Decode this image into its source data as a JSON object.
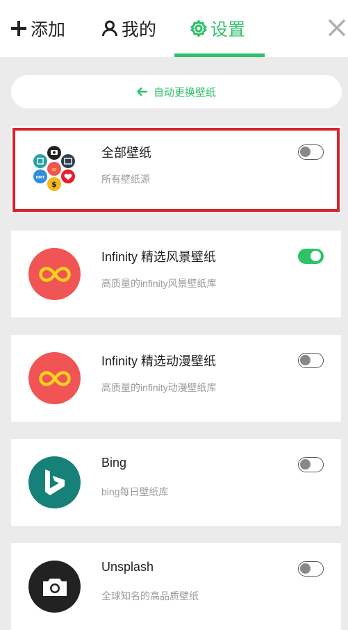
{
  "header": {
    "tabs": [
      {
        "label": "添加",
        "icon": "plus-icon",
        "active": false
      },
      {
        "label": "我的",
        "icon": "user-icon",
        "active": false
      },
      {
        "label": "设置",
        "icon": "gear-icon",
        "active": true
      }
    ],
    "close_icon": "close-icon",
    "accent_color": "#2ec26a"
  },
  "auto_change": {
    "label": "自动更换壁纸",
    "icon": "arrow-left-icon"
  },
  "sources": [
    {
      "title": "全部壁纸",
      "subtitle": "所有壁纸源",
      "enabled": false,
      "selected": true,
      "icon": "all-sources-icon"
    },
    {
      "title": "Infinity 精选风景壁纸",
      "subtitle": "高质量的infinity风景壁纸库",
      "enabled": true,
      "selected": false,
      "icon": "infinity-icon",
      "color": "#f05454"
    },
    {
      "title": "Infinity 精选动漫壁纸",
      "subtitle": "高质量的infinity动漫壁纸库",
      "enabled": false,
      "selected": false,
      "icon": "infinity-icon",
      "color": "#f05454"
    },
    {
      "title": "Bing",
      "subtitle": "bing每日壁纸库",
      "enabled": false,
      "selected": false,
      "icon": "bing-icon",
      "color": "#168179"
    },
    {
      "title": "Unsplash",
      "subtitle": "全球知名的高品质壁纸",
      "enabled": false,
      "selected": false,
      "icon": "camera-icon",
      "color": "#222222"
    }
  ]
}
